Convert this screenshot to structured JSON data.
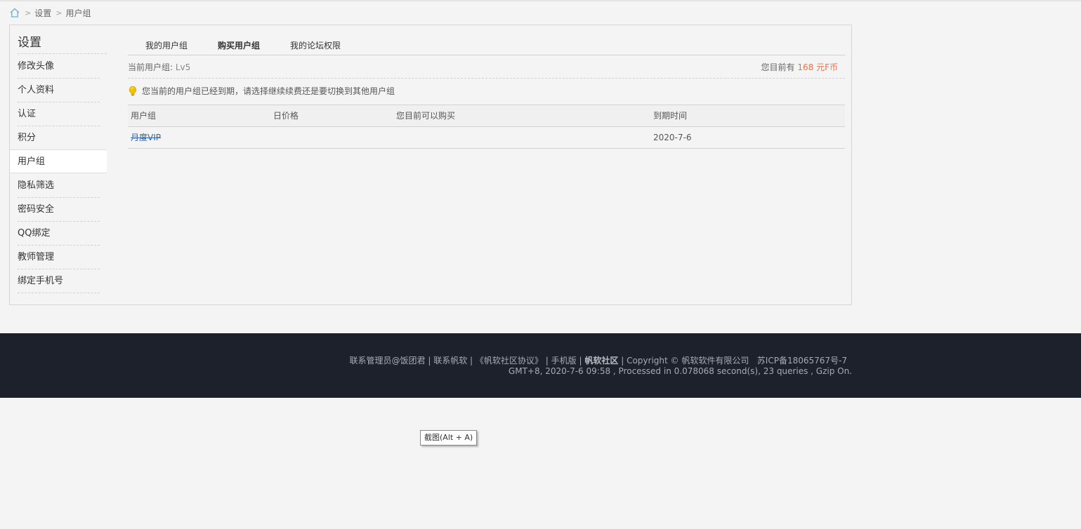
{
  "breadcrumb": {
    "home_icon": "home-icon",
    "items": [
      "设置",
      "用户组"
    ]
  },
  "sidebar": {
    "title": "设置",
    "items": [
      {
        "label": "修改头像",
        "active": false
      },
      {
        "label": "个人资料",
        "active": false
      },
      {
        "label": "认证",
        "active": false
      },
      {
        "label": "积分",
        "active": false
      },
      {
        "label": "用户组",
        "active": true
      },
      {
        "label": "隐私筛选",
        "active": false
      },
      {
        "label": "密码安全",
        "active": false
      },
      {
        "label": "QQ绑定",
        "active": false
      },
      {
        "label": "教师管理",
        "active": false
      },
      {
        "label": "绑定手机号",
        "active": false
      }
    ]
  },
  "tabs": [
    {
      "label": "我的用户组",
      "active": false
    },
    {
      "label": "购买用户组",
      "active": true
    },
    {
      "label": "我的论坛权限",
      "active": false
    }
  ],
  "group_info": {
    "current_label": "当前用户组: ",
    "current_value": "Lv5",
    "balance_prefix": "您目前有 ",
    "balance_value": "168 元F币"
  },
  "notice": {
    "icon": "lightbulb-icon",
    "text": "您当前的用户组已经到期，请选择继续续费还是要切换到其他用户组"
  },
  "table": {
    "headers": [
      "用户组",
      "日价格",
      "您目前可以购买",
      "到期时间"
    ],
    "rows": [
      {
        "group": "月度VIP",
        "price": "",
        "can_buy": "",
        "expiry": "2020-7-6"
      }
    ]
  },
  "footer": {
    "contact_admin": "联系管理员@饭团君",
    "contact_company": "联系帆软",
    "agreement": "《帆软社区协议》",
    "mobile": "手机版",
    "community": "帆软社区",
    "copyright": "Copyright © 帆软软件有限公司",
    "icp": "苏ICP备18065767号-7",
    "stats": "GMT+8, 2020-7-6 09:58 , Processed in 0.078068 second(s), 23 queries , Gzip On.",
    "separator": "|"
  },
  "tooltip": {
    "text": "截图(Alt + A)"
  },
  "colors": {
    "background": "#f3f4f3",
    "footer_bg": "#1c212b",
    "coin": "#e8734a",
    "link": "#3366aa"
  }
}
